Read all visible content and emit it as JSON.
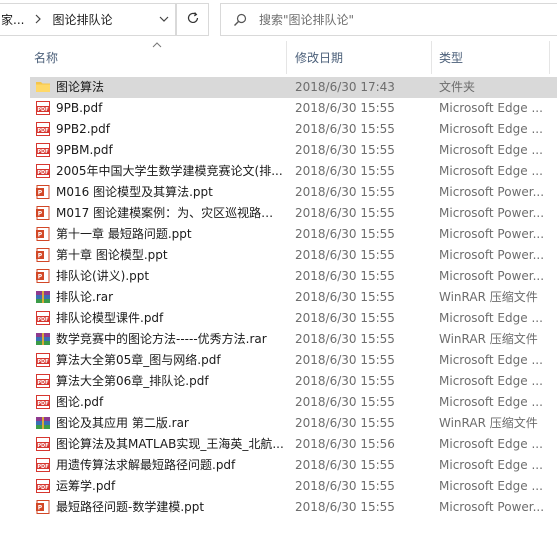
{
  "address": {
    "prev_crumb": "家...",
    "current": "图论排队论"
  },
  "search": {
    "placeholder": "搜索\"图论排队论\""
  },
  "columns": {
    "name": "名称",
    "date": "修改日期",
    "type": "类型"
  },
  "colors": {
    "selected_bg": "#d9d9d9",
    "header_text": "#4c607a",
    "pdf_red": "#d6362f",
    "ppt_orange": "#d24726",
    "folder_yellow": "#f5c54b"
  },
  "files": [
    {
      "icon": "folder-icon",
      "name": "图论算法",
      "date": "2018/6/30 17:43",
      "type": "文件夹",
      "selected": true
    },
    {
      "icon": "pdf-icon",
      "name": "9PB.pdf",
      "date": "2018/6/30 15:55",
      "type": "Microsoft Edge ..."
    },
    {
      "icon": "pdf-icon",
      "name": "9PB2.pdf",
      "date": "2018/6/30 15:55",
      "type": "Microsoft Edge ..."
    },
    {
      "icon": "pdf-icon",
      "name": "9PBM.pdf",
      "date": "2018/6/30 15:55",
      "type": "Microsoft Edge ..."
    },
    {
      "icon": "pdf-icon",
      "name": "2005年中国大学生数学建模竞赛论文(排...",
      "date": "2018/6/30 15:55",
      "type": "Microsoft Edge ..."
    },
    {
      "icon": "ppt-icon",
      "name": "M016 图论模型及其算法.ppt",
      "date": "2018/6/30 15:55",
      "type": "Microsoft Power..."
    },
    {
      "icon": "ppt-icon",
      "name": "M017 图论建模案例：为、灾区巡视路线...",
      "date": "2018/6/30 15:55",
      "type": "Microsoft Power..."
    },
    {
      "icon": "ppt-icon",
      "name": "第十一章  最短路问题.ppt",
      "date": "2018/6/30 15:55",
      "type": "Microsoft Power..."
    },
    {
      "icon": "ppt-icon",
      "name": "第十章  图论模型.ppt",
      "date": "2018/6/30 15:55",
      "type": "Microsoft Power..."
    },
    {
      "icon": "ppt-icon",
      "name": "排队论(讲义).ppt",
      "date": "2018/6/30 15:55",
      "type": "Microsoft Power..."
    },
    {
      "icon": "rar-icon",
      "name": "排队论.rar",
      "date": "2018/6/30 15:55",
      "type": "WinRAR 压缩文件"
    },
    {
      "icon": "pdf-icon",
      "name": "排队论模型课件.pdf",
      "date": "2018/6/30 15:55",
      "type": "Microsoft Edge ..."
    },
    {
      "icon": "rar-icon",
      "name": "数学竞赛中的图论方法-----优秀方法.rar",
      "date": "2018/6/30 15:55",
      "type": "WinRAR 压缩文件"
    },
    {
      "icon": "pdf-icon",
      "name": "算法大全第05章_图与网络.pdf",
      "date": "2018/6/30 15:55",
      "type": "Microsoft Edge ..."
    },
    {
      "icon": "pdf-icon",
      "name": "算法大全第06章_排队论.pdf",
      "date": "2018/6/30 15:55",
      "type": "Microsoft Edge ..."
    },
    {
      "icon": "pdf-icon",
      "name": "图论.pdf",
      "date": "2018/6/30 15:55",
      "type": "Microsoft Edge ..."
    },
    {
      "icon": "rar-icon",
      "name": "图论及其应用 第二版.rar",
      "date": "2018/6/30 15:55",
      "type": "WinRAR 压缩文件"
    },
    {
      "icon": "pdf-icon",
      "name": "图论算法及其MATLAB实现_王海英_北航...",
      "date": "2018/6/30 15:56",
      "type": "Microsoft Edge ..."
    },
    {
      "icon": "pdf-icon",
      "name": "用遗传算法求解最短路径问题.pdf",
      "date": "2018/6/30 15:55",
      "type": "Microsoft Edge ..."
    },
    {
      "icon": "pdf-icon",
      "name": "运筹学.pdf",
      "date": "2018/6/30 15:55",
      "type": "Microsoft Edge ..."
    },
    {
      "icon": "ppt-icon",
      "name": "最短路径问题-数学建模.ppt",
      "date": "2018/6/30 15:55",
      "type": "Microsoft Power..."
    }
  ]
}
